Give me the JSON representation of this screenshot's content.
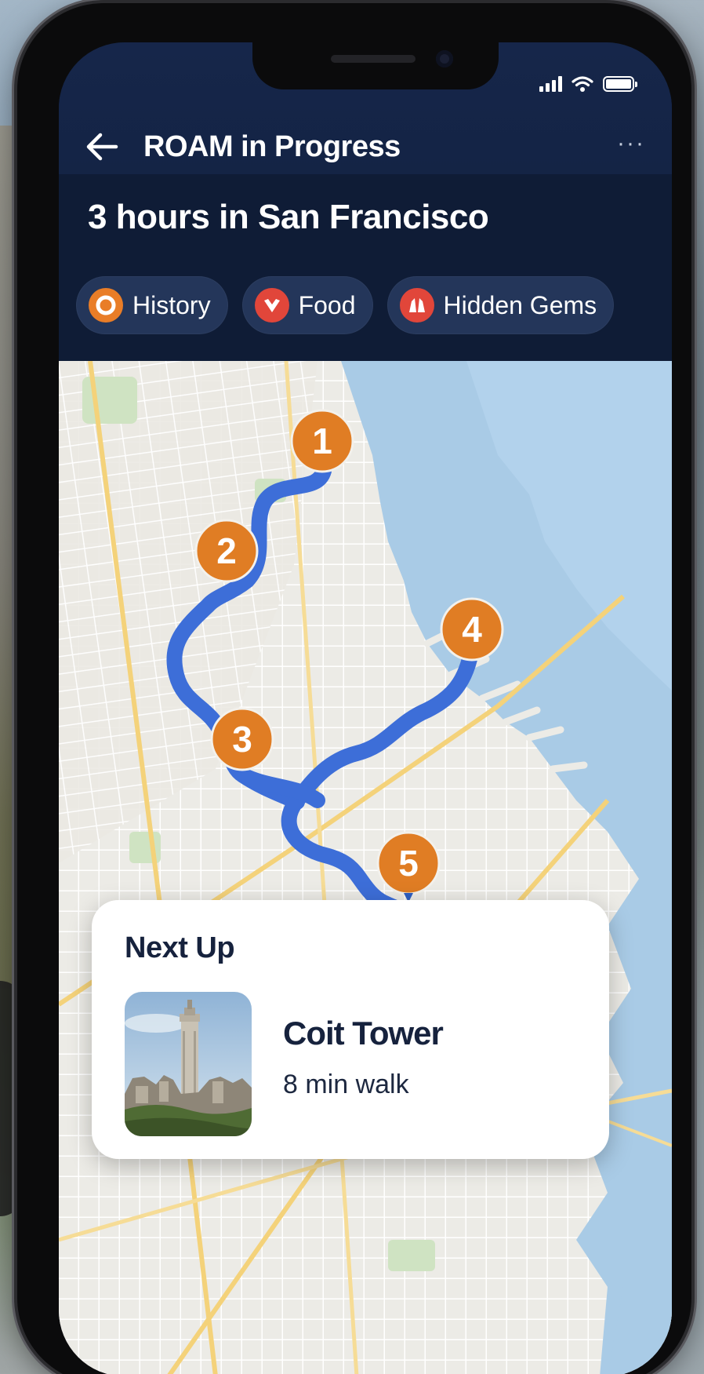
{
  "app_bar": {
    "title": "ROAM in Progress",
    "back_icon": "arrow-left-icon",
    "more_icon": "more-horizontal-icon",
    "more_label": "···"
  },
  "status_bar": {
    "icons": [
      "cellular-signal-icon",
      "wifi-icon",
      "battery-icon"
    ]
  },
  "trip": {
    "title": "3 hours in San Francisco"
  },
  "filters": [
    {
      "label": "History",
      "icon": "history-circle-icon",
      "color": "#e97d27"
    },
    {
      "label": "Food",
      "icon": "food-heart-icon",
      "color": "#e1463a"
    },
    {
      "label": "Hidden Gems",
      "icon": "gem-landmark-icon",
      "color": "#e1463a"
    }
  ],
  "map": {
    "route_color": "#3d6ed8",
    "marker_color": "#e07d24",
    "stops": [
      "1",
      "2",
      "3",
      "4",
      "5"
    ]
  },
  "next_up": {
    "label": "Next Up",
    "place_name": "Coit Tower",
    "distance": "8 min walk",
    "thumbnail": "coit-tower-photo"
  }
}
